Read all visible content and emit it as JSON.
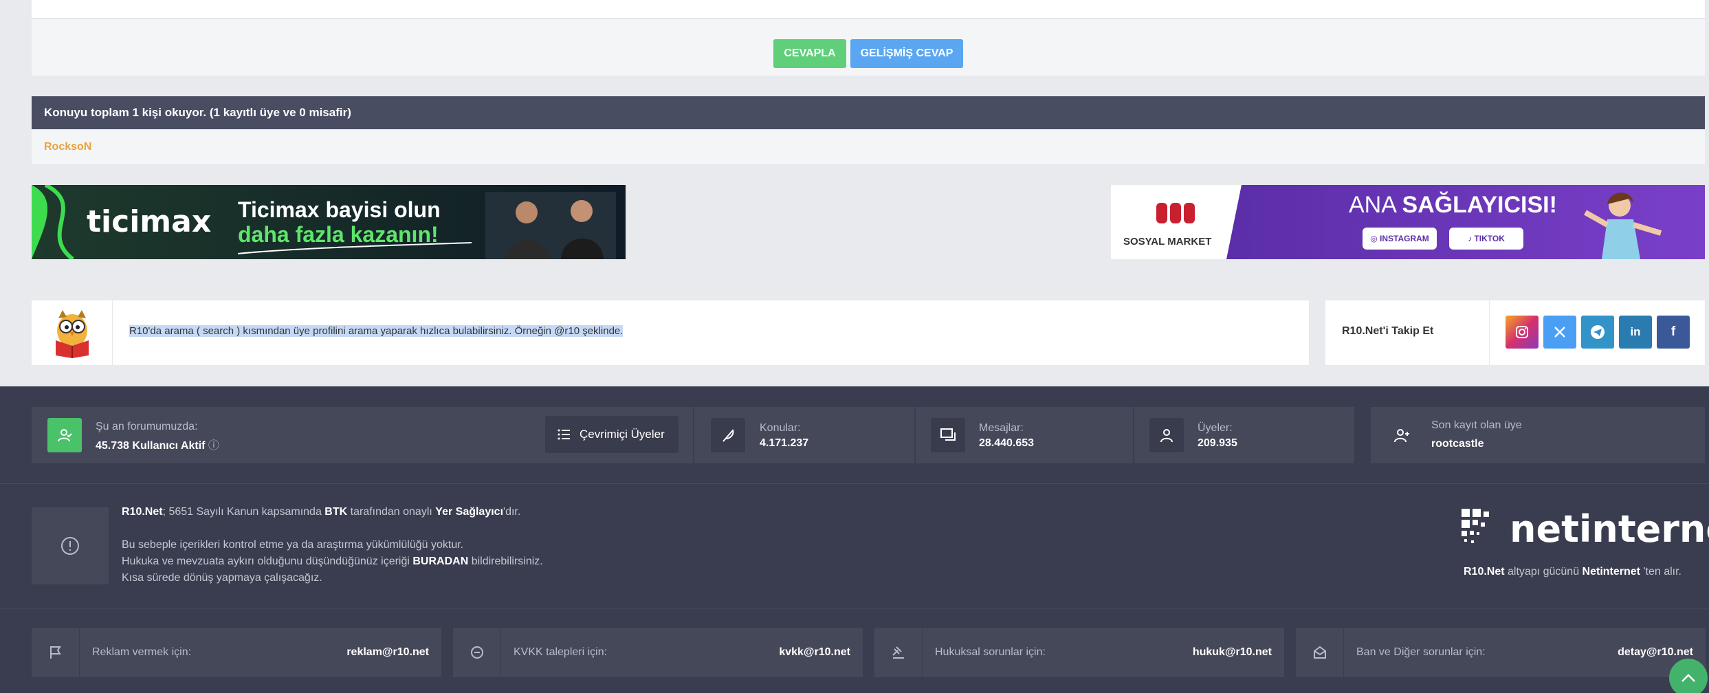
{
  "reply": {
    "reply_label": "CEVAPLA",
    "advanced_label": "GELİŞMİŞ CEVAP"
  },
  "readers": {
    "heading": "Konuyu toplam 1 kişi okuyor. (1 kayıtlı üye ve 0 misafir)",
    "names": [
      "RocksoN"
    ]
  },
  "ads": {
    "left": {
      "logo": "ticimax",
      "line1": "Ticimax bayisi olun",
      "line2": "daha fazla kazanın!"
    },
    "right": {
      "brand": "SOSYAL MARKET",
      "headline_a": "ANA ",
      "headline_b": "SAĞLAYICISI!",
      "chip1": "INSTAGRAM",
      "chip2": "TIKTOK"
    }
  },
  "tip": {
    "text": "R10'da arama ( search ) kısmından üye profilini arama yaparak hızlıca bulabilirsiniz. Örneğin @r10 şeklinde."
  },
  "follow": {
    "label": "R10.Net'i Takip Et",
    "networks": [
      {
        "name": "instagram",
        "glyph": "◎",
        "color": "#d6306d"
      },
      {
        "name": "x",
        "glyph": "X",
        "color": "#4a9ff5"
      },
      {
        "name": "telegram",
        "glyph": "➤",
        "color": "#3293c9"
      },
      {
        "name": "linkedin",
        "glyph": "in",
        "color": "#2a7bb0"
      },
      {
        "name": "facebook",
        "glyph": "f",
        "color": "#3b5998"
      }
    ]
  },
  "stats": {
    "online_label": "Şu an forumumuzda:",
    "online_value": "45.738 Kullanıcı Aktif",
    "online_button": "Çevrimiçi Üyeler",
    "topics_label": "Konular:",
    "topics_value": "4.171.237",
    "messages_label": "Mesajlar:",
    "messages_value": "28.440.653",
    "members_label": "Üyeler:",
    "members_value": "209.935",
    "last_label": "Son kayıt olan üye",
    "last_value": "rootcastle"
  },
  "legal": {
    "l1_a": "R10.Net",
    "l1_b": "; 5651 Sayılı Kanun kapsamında ",
    "l1_c": "BTK",
    "l1_d": " tarafından onaylı ",
    "l1_e": "Yer Sağlayıcı",
    "l1_f": "'dır.",
    "l2": "Bu sebeple içerikleri kontrol etme ya da araştırma yükümlülüğü yoktur.",
    "l3_a": "Hukuka ve mevzuata aykırı olduğunu düşündüğünüz içeriği ",
    "l3_b": "BURADAN",
    "l3_c": " bildirebilirsiniz.",
    "l4": "Kısa sürede dönüş yapmaya çalışacağız."
  },
  "provider": {
    "logo": "netinternet",
    "c_a": "R10.Net",
    "c_b": " altyapı gücünü ",
    "c_c": "Netinternet",
    "c_d": " 'ten alır."
  },
  "contacts": [
    {
      "label": "Reklam vermek için:",
      "email": "reklam@r10.net"
    },
    {
      "label": "KVKK talepleri için:",
      "email": "kvkk@r10.net"
    },
    {
      "label": "Hukuksal sorunlar için:",
      "email": "hukuk@r10.net"
    },
    {
      "label": "Ban ve Diğer sorunlar için:",
      "email": "detay@r10.net"
    }
  ]
}
